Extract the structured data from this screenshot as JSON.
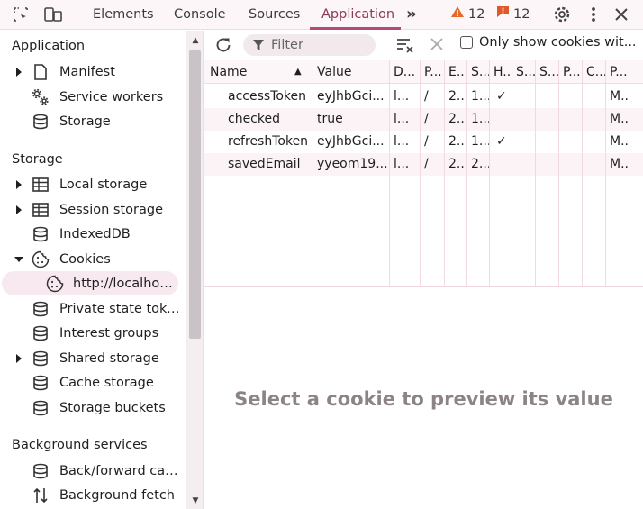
{
  "toolbar": {
    "tabs": [
      "Elements",
      "Console",
      "Sources",
      "Application"
    ],
    "active_tab": "Application",
    "more_tabs_glyph": "»",
    "warnings_count": "12",
    "issues_count": "12",
    "icons": [
      "inspect-icon",
      "device-toolbar-icon",
      "warning-icon",
      "issues-icon",
      "gear-icon",
      "kebab-menu-icon",
      "close-icon"
    ],
    "colors": {
      "accent": "#b34a77",
      "warning": "#e46a2a",
      "issue": "#e0582a"
    }
  },
  "sidebar": {
    "sections": [
      {
        "title": "Application",
        "items": [
          {
            "label": "Manifest",
            "icon": "document-icon",
            "expandable": true
          },
          {
            "label": "Service workers",
            "icon": "gears-icon",
            "expandable": false
          },
          {
            "label": "Storage",
            "icon": "database-icon",
            "expandable": false
          }
        ]
      },
      {
        "title": "Storage",
        "items": [
          {
            "label": "Local storage",
            "icon": "table-icon",
            "expandable": true
          },
          {
            "label": "Session storage",
            "icon": "table-icon",
            "expandable": true
          },
          {
            "label": "IndexedDB",
            "icon": "database-icon",
            "expandable": false
          },
          {
            "label": "Cookies",
            "icon": "cookie-icon",
            "expandable": true,
            "expanded": true
          },
          {
            "label": "http://localhos...",
            "icon": "cookie-icon",
            "selected": true
          },
          {
            "label": "Private state toke...",
            "icon": "database-icon",
            "expandable": false
          },
          {
            "label": "Interest groups",
            "icon": "database-icon",
            "expandable": false
          },
          {
            "label": "Shared storage",
            "icon": "database-icon",
            "expandable": true
          },
          {
            "label": "Cache storage",
            "icon": "database-icon",
            "expandable": false
          },
          {
            "label": "Storage buckets",
            "icon": "database-icon",
            "expandable": false
          }
        ]
      },
      {
        "title": "Background services",
        "items": [
          {
            "label": "Back/forward cac...",
            "icon": "database-icon",
            "expandable": false
          },
          {
            "label": "Background fetch",
            "icon": "sync-arrows-icon",
            "expandable": false
          }
        ]
      }
    ]
  },
  "cookies_toolbar": {
    "filter_placeholder": "Filter",
    "only_show_label": "Only show cookies wit...",
    "icons": [
      "refresh-icon",
      "filter-icon",
      "clear-all-icon",
      "delete-icon"
    ]
  },
  "cookie_table": {
    "columns": [
      "Name",
      "Value",
      "D...",
      "P...",
      "E...",
      "S...",
      "H...",
      "S...",
      "S...",
      "P...",
      "C...",
      "P..."
    ],
    "sort_indicator": "▲",
    "rows": [
      [
        "accessToken",
        "eyJhbGci...",
        "l...",
        "/",
        "2...",
        "1...",
        "✓",
        "",
        "",
        "",
        "",
        "M.."
      ],
      [
        "checked",
        "true",
        "l...",
        "/",
        "2...",
        "1...",
        "",
        "",
        "",
        "",
        "",
        "M.."
      ],
      [
        "refreshToken",
        "eyJhbGci...",
        "l...",
        "/",
        "2...",
        "1...",
        "✓",
        "",
        "",
        "",
        "",
        "M.."
      ],
      [
        "savedEmail",
        "yyeom19...",
        "l...",
        "/",
        "2...",
        "2...",
        "",
        "",
        "",
        "",
        "",
        "M.."
      ]
    ]
  },
  "preview": {
    "message": "Select a cookie to preview its value"
  }
}
